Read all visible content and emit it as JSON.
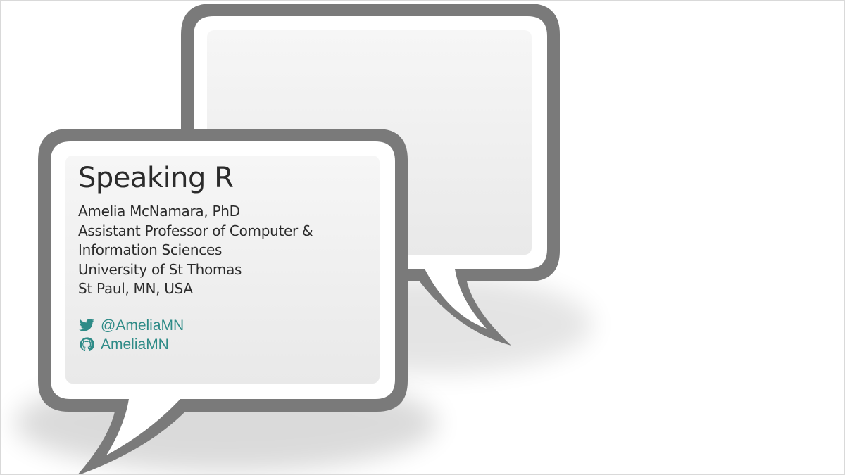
{
  "slide": {
    "title": "Speaking R",
    "author_lines": [
      "Amelia McNamara, PhD",
      "Assistant Professor of Computer &",
      "Information Sciences",
      "University of St Thomas",
      "St Paul, MN, USA"
    ],
    "social": {
      "twitter": {
        "icon": "twitter-icon",
        "handle": "@AmeliaMN"
      },
      "github": {
        "icon": "github-icon",
        "handle": "AmeliaMN"
      }
    }
  },
  "colors": {
    "bubble_border": "#7a7a7a",
    "bubble_fill": "#efefef",
    "link": "#2e8b87",
    "text": "#2b2b2b"
  }
}
